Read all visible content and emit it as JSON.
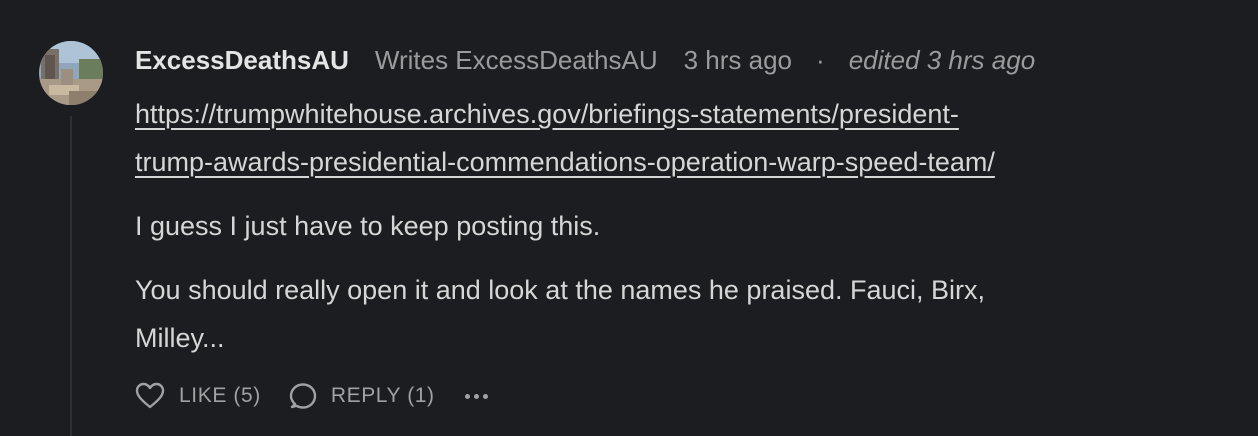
{
  "comment": {
    "author": "ExcessDeathsAU",
    "writes": "Writes ExcessDeathsAU",
    "time": "3 hrs ago",
    "separator": "·",
    "edited": "edited 3 hrs ago",
    "link_line1": "https://trumpwhitehouse.archives.gov/briefings-statements/president-",
    "link_line2": "trump-awards-presidential-commendations-operation-warp-speed-team/",
    "paragraph1": "I guess I just have to keep posting this.",
    "paragraph2_line1": "You should really open it and look at the names he praised. Fauci, Birx,",
    "paragraph2_line2": "Milley..."
  },
  "actions": {
    "like_label": "LIKE (5)",
    "reply_label": "REPLY (1)",
    "like_icon": "heart-icon",
    "reply_icon": "speech-bubble-icon",
    "more_icon": "ellipsis-icon"
  }
}
